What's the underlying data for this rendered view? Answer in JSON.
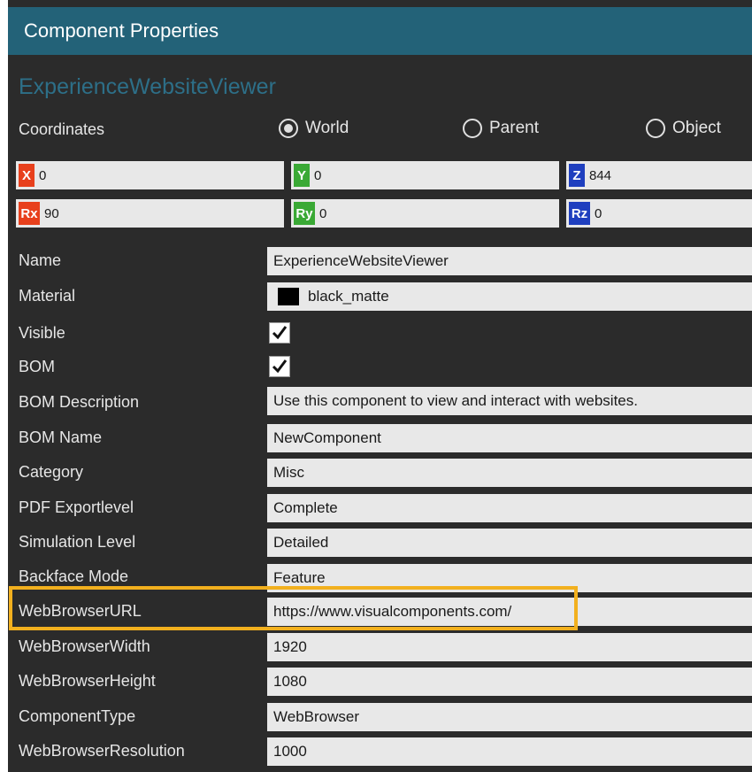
{
  "panel": {
    "title": "Component Properties",
    "component_name": "ExperienceWebsiteViewer",
    "coordinates": {
      "label": "Coordinates",
      "options": [
        "World",
        "Parent",
        "Object"
      ],
      "selected": "World"
    },
    "position": {
      "x": {
        "axis": "X",
        "value": "0",
        "color": "#e8401c"
      },
      "y": {
        "axis": "Y",
        "value": "0",
        "color": "#3aa935"
      },
      "z": {
        "axis": "Z",
        "value": "844",
        "color": "#1f3fbf"
      }
    },
    "rotation": {
      "rx": {
        "axis": "Rx",
        "value": "90",
        "color": "#e8401c"
      },
      "ry": {
        "axis": "Ry",
        "value": "0",
        "color": "#3aa935"
      },
      "rz": {
        "axis": "Rz",
        "value": "0",
        "color": "#1f3fbf"
      }
    },
    "properties": {
      "name": {
        "label": "Name",
        "value": "ExperienceWebsiteViewer"
      },
      "material": {
        "label": "Material",
        "value": "black_matte",
        "swatch_color": "#000000"
      },
      "visible": {
        "label": "Visible",
        "checked": true
      },
      "bom": {
        "label": "BOM",
        "checked": true
      },
      "bom_description": {
        "label": "BOM Description",
        "value": "Use this component to view and interact with websites."
      },
      "bom_name": {
        "label": "BOM Name",
        "value": "NewComponent"
      },
      "category": {
        "label": "Category",
        "value": "Misc"
      },
      "pdf_exportlevel": {
        "label": "PDF Exportlevel",
        "value": "Complete"
      },
      "simulation_level": {
        "label": "Simulation Level",
        "value": "Detailed"
      },
      "backface_mode": {
        "label": "Backface Mode",
        "value": "Feature"
      },
      "webbrowser_url": {
        "label": "WebBrowserURL",
        "value": "https://www.visualcomponents.com/"
      },
      "webbrowser_width": {
        "label": "WebBrowserWidth",
        "value": "1920"
      },
      "webbrowser_height": {
        "label": "WebBrowserHeight",
        "value": "1080"
      },
      "component_type": {
        "label": "ComponentType",
        "value": "WebBrowser"
      },
      "webbrowser_resolution": {
        "label": "WebBrowserResolution",
        "value": "1000"
      }
    },
    "highlight_color": "#f2b01e"
  }
}
